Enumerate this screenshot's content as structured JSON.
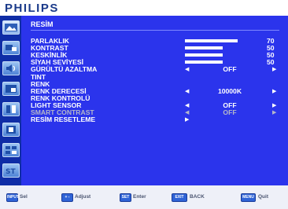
{
  "brand": {
    "logo_text": "PHILIPS"
  },
  "menu": {
    "title": "RESİM",
    "rows": [
      {
        "label": "PARLAKLIK",
        "type": "slider",
        "value": 70,
        "enabled": true
      },
      {
        "label": "KONTRAST",
        "type": "slider",
        "value": 50,
        "enabled": true
      },
      {
        "label": "KESKİNLİK",
        "type": "slider",
        "value": 50,
        "enabled": true
      },
      {
        "label": "SİYAH SEVİYESİ",
        "type": "slider",
        "value": 50,
        "enabled": true
      },
      {
        "label": "GÜRÜLTÜ AZALTMA",
        "type": "select",
        "value": "OFF",
        "enabled": true
      },
      {
        "label": "TINT",
        "type": "none",
        "enabled": true
      },
      {
        "label": "RENK",
        "type": "none",
        "enabled": true
      },
      {
        "label": "RENK DERECESİ",
        "type": "select",
        "value": "10000K",
        "enabled": true
      },
      {
        "label": "RENK KONTROLÜ",
        "type": "none",
        "enabled": true
      },
      {
        "label": "LIGHT SENSOR",
        "type": "select",
        "value": "OFF",
        "enabled": true
      },
      {
        "label": "SMART CONTRAST",
        "type": "select",
        "value": "OFF",
        "enabled": false
      },
      {
        "label": "RESİM RESETLEME",
        "type": "submenu",
        "enabled": true
      }
    ]
  },
  "sidebar": {
    "icons": [
      "picture-icon",
      "screen-icon",
      "audio-icon",
      "pip-icon",
      "configuration-icon",
      "advanced-option-icon",
      "tiling-icon",
      "input-icon"
    ]
  },
  "footer": {
    "keys": [
      {
        "button": "INPUT",
        "label": "Sel"
      },
      {
        "button": "+ -",
        "label": "Adjust"
      },
      {
        "button": "SET",
        "label": "Enter"
      },
      {
        "button": "EXIT",
        "label": "BACK"
      },
      {
        "button": "MENU",
        "label": "Quit"
      }
    ]
  },
  "colors": {
    "panel": "#2b34ec",
    "sidebar": "#0f2da6",
    "text": "#ffffff",
    "disabled_text": "#b5b8c8",
    "logo": "#1a3a8a"
  }
}
